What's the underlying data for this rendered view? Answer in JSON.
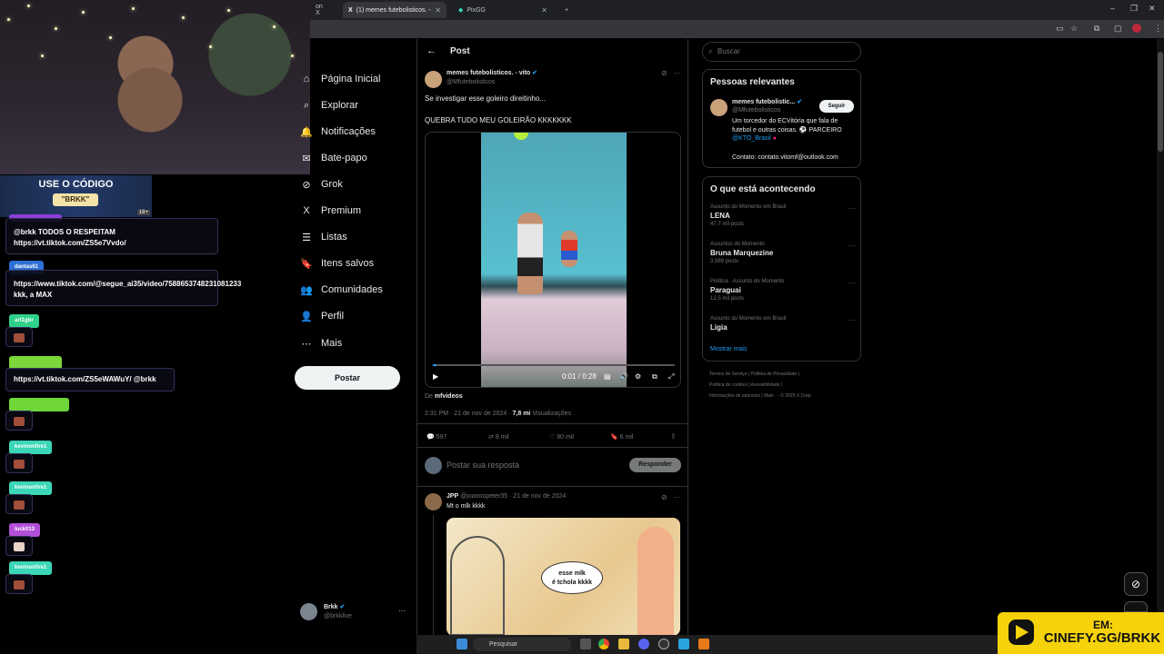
{
  "browser": {
    "tabs": [
      {
        "title": "on X",
        "active": false
      },
      {
        "title": "(1) memes futebolisticos. -",
        "active": true
      },
      {
        "title": "PixGG",
        "active": false
      }
    ],
    "new_tab": "+",
    "window_controls": [
      "–",
      "❐",
      "✕"
    ]
  },
  "stream": {
    "promo_line1": "USE O CÓDIGO",
    "promo_code": "\"BRKK\"",
    "promo_age": "18+",
    "chat": [
      {
        "user": "",
        "message": "@brkk TODOS O RESPEITAM\nhttps://vt.tiktok.com/ZS5e7Vvdo/",
        "color": "#8b3fd9"
      },
      {
        "user": "dantas61",
        "message": "https://www.tiktok.com/@segue_ai35/video/7588653748231081233 kkk, a MAX",
        "color": "#2d6fd6"
      },
      {
        "user": "art1gbr",
        "message": "",
        "color": "#2fd18a"
      },
      {
        "user": "",
        "message": "https://vt.tiktok.com/ZS5eWAWuY/ @brkk",
        "color": "#7bd63a"
      },
      {
        "user": "",
        "message": "",
        "color": "#6fd63a"
      },
      {
        "user": "kevinonfire1",
        "message": "",
        "color": "#3ad6b6"
      },
      {
        "user": "kevinonfire1",
        "message": "",
        "color": "#3ad6b6"
      },
      {
        "user": "luck013",
        "message": "",
        "color": "#b14fd9"
      },
      {
        "user": "kevinonfire1",
        "message": "",
        "color": "#3ad6b6"
      }
    ]
  },
  "nav": {
    "items": [
      {
        "label": "Página Inicial",
        "icon": "⌂"
      },
      {
        "label": "Explorar",
        "icon": "⌕"
      },
      {
        "label": "Notificações",
        "icon": "🔔"
      },
      {
        "label": "Bate-papo",
        "icon": "✉"
      },
      {
        "label": "Grok",
        "icon": "⊘"
      },
      {
        "label": "Premium",
        "icon": "X"
      },
      {
        "label": "Listas",
        "icon": "☰"
      },
      {
        "label": "Itens salvos",
        "icon": "🔖"
      },
      {
        "label": "Comunidades",
        "icon": "👥"
      },
      {
        "label": "Perfil",
        "icon": "👤"
      },
      {
        "label": "Mais",
        "icon": "⋯"
      }
    ],
    "post_button": "Postar",
    "account": {
      "name": "Brkk",
      "handle": "@brkklive",
      "more": "···"
    }
  },
  "post": {
    "header": "Post",
    "back_icon": "←",
    "author_name": "memes futebolisticos. - vito",
    "author_handle": "@Mfutebolisticos",
    "text1": "Se investigar esse goleiro direitinho...",
    "text2": "QUEBRA TUDO MEU GOLEIRÃO KKKKKKK",
    "video_time": "0:01 / 0:28",
    "source_prefix": "De",
    "source": "mfvideos",
    "timestamp": "2:31 PM · 21 de nov de 2024 ·",
    "views_count": "7,8 mi",
    "views_label": "Visualizações",
    "stats": {
      "replies": "597",
      "retweets": "8 mil",
      "likes": "90 mil",
      "bookmarks": "6 mil"
    },
    "reply_placeholder": "Postar sua resposta",
    "reply_button": "Responder"
  },
  "reply": {
    "author": "JPP",
    "handle_date": "@joaooopeter35 · 21 de nov de 2024",
    "text": "Mt o mlk kkkk",
    "comic_text": "esse mlk\né tchola kkkk"
  },
  "sidebar": {
    "search_placeholder": "Buscar",
    "relevant_title": "Pessoas relevantes",
    "relevant": {
      "name": "memes futebolistic...",
      "handle": "@Mfutebolisticos",
      "follow": "Seguir",
      "bio": "Um torcedor do ECVitória que fala de futebol e outras coisas. ⚽ PARCEIRO",
      "bio_link": "@KTO_Brasil",
      "contact": "Contato: contato.vitomf@outlook.com"
    },
    "trending_title": "O que está acontecendo",
    "trends": [
      {
        "category": "Assunto do Momento em Brasil",
        "name": "LENA",
        "count": "47,7 mil posts"
      },
      {
        "category": "Assuntos do Momento",
        "name": "Bruna Marquezine",
        "count": "3.589 posts"
      },
      {
        "category": "Política · Assunto do Momento",
        "name": "Paraguai",
        "count": "12,5 mil posts"
      },
      {
        "category": "Assunto do Momento em Brasil",
        "name": "Ligia",
        "count": ""
      }
    ],
    "show_more": "Mostrar mais",
    "footer": [
      "Termos de Serviço | Política de Privacidade |",
      "Política de cookies | Acessibilidade |",
      "Informações de anúncios | Mais ··· © 2025 X Corp."
    ]
  },
  "overlay": {
    "cinefy_line1": "EM:",
    "cinefy_line2": "CINEFY.GG/BRKK"
  },
  "taskbar": {
    "search": "Pesquisar"
  }
}
